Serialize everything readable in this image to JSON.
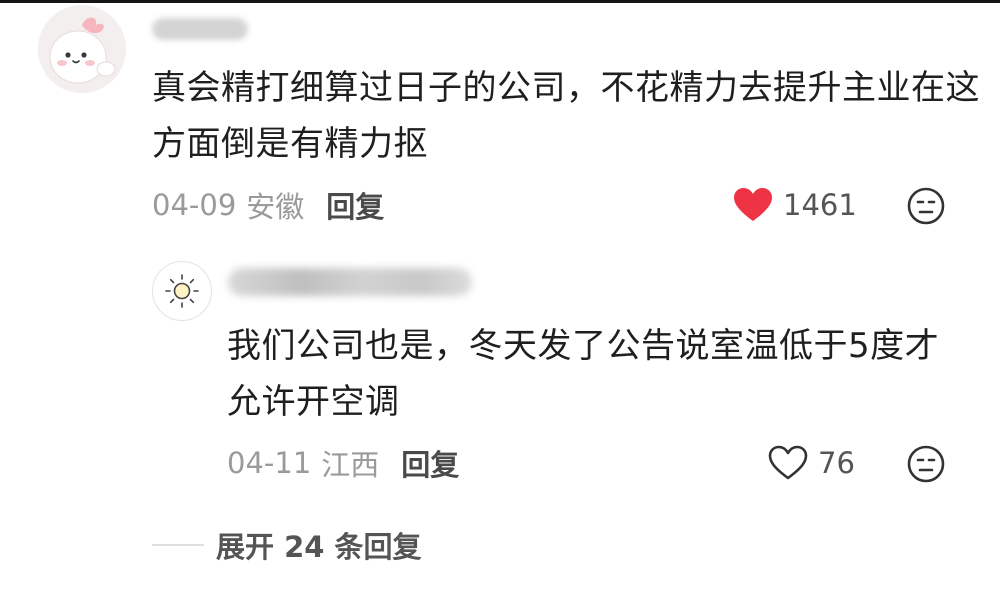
{
  "comments": {
    "main": {
      "text": "真会精打细算过日子的公司，不花精力去提升主业在这方面倒是有精力抠",
      "date": "04-09",
      "region": "安徽",
      "reply_label": "回复",
      "like_count": "1461",
      "liked": true,
      "avatar_icon": "cartoon-avatar-icon"
    },
    "reply": {
      "text": "我们公司也是，冬天发了公告说室温低于5度才允许开空调",
      "date": "04-11",
      "region": "江西",
      "reply_label": "回复",
      "like_count": "76",
      "liked": false,
      "avatar_icon": "sun-avatar-icon"
    }
  },
  "expand": {
    "label": "展开 24 条回复"
  },
  "colors": {
    "like_active": "#ee3344",
    "text_primary": "#1f1f1f",
    "text_muted": "#9a9a9a"
  }
}
